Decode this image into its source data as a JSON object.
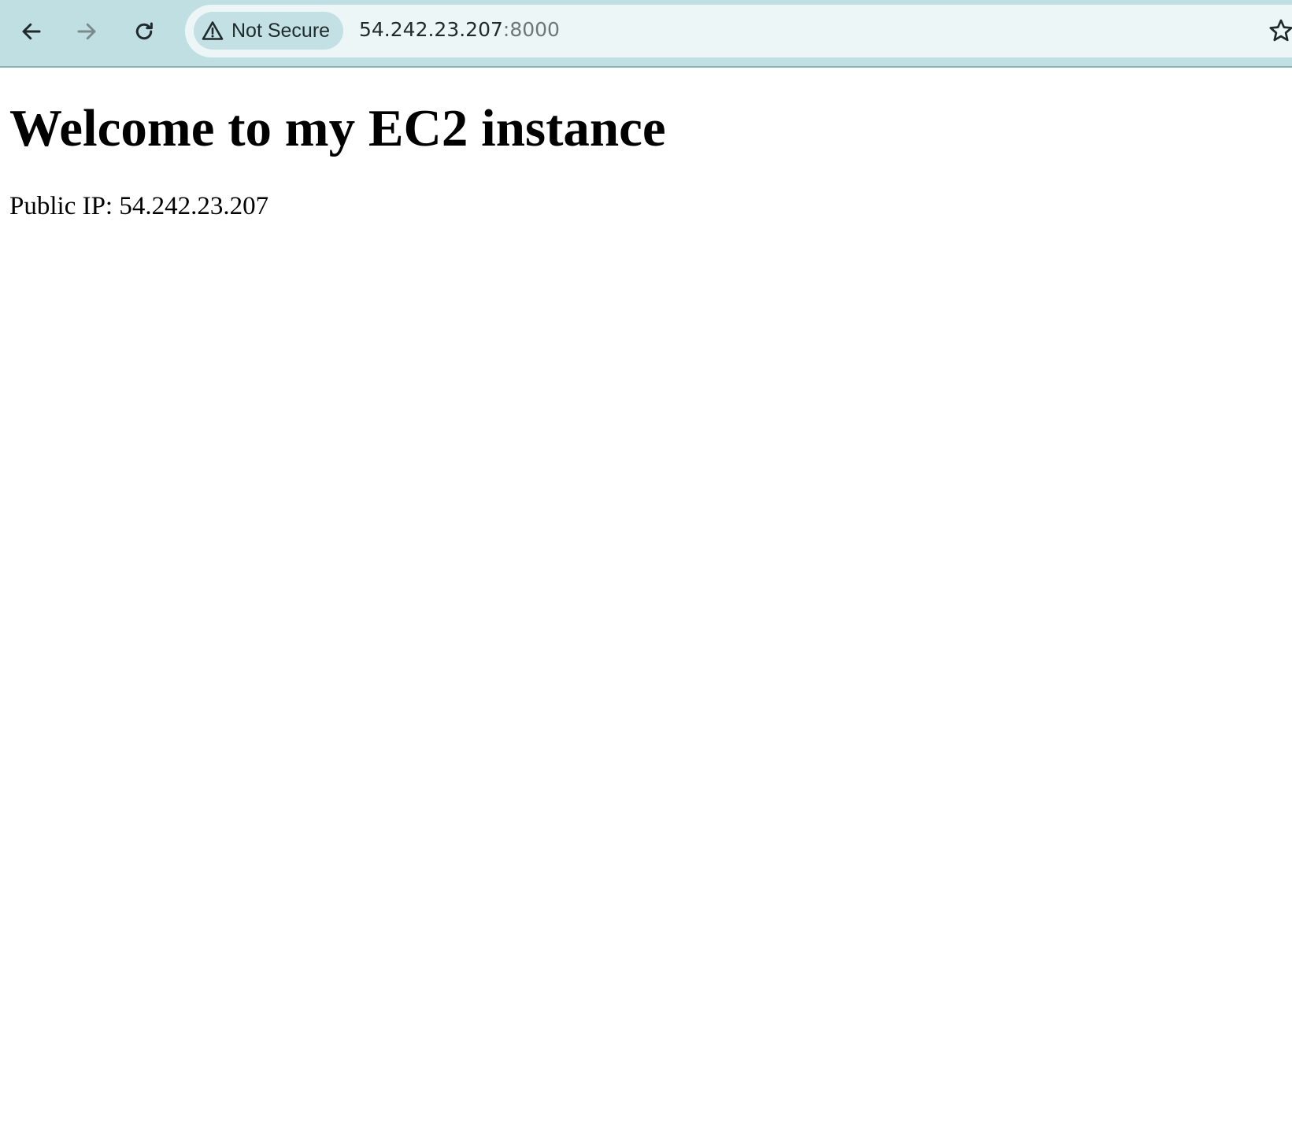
{
  "browser": {
    "toolbar": {
      "back_icon": "arrow-left-icon",
      "forward_icon": "arrow-right-icon",
      "forward_enabled": false,
      "reload_icon": "reload-icon",
      "bookmark_icon": "star-icon"
    },
    "omnibox": {
      "security_icon": "warning-triangle-icon",
      "security_label": "Not Secure",
      "url_host": "54.242.23.207",
      "url_port": ":8000"
    },
    "colors": {
      "toolbar_bg": "#bfdfe3",
      "omnibox_bg": "#edf6f7",
      "chip_bg": "#c3e0e4"
    }
  },
  "page": {
    "heading": "Welcome to my EC2 instance",
    "paragraph": "Public IP: 54.242.23.207"
  }
}
